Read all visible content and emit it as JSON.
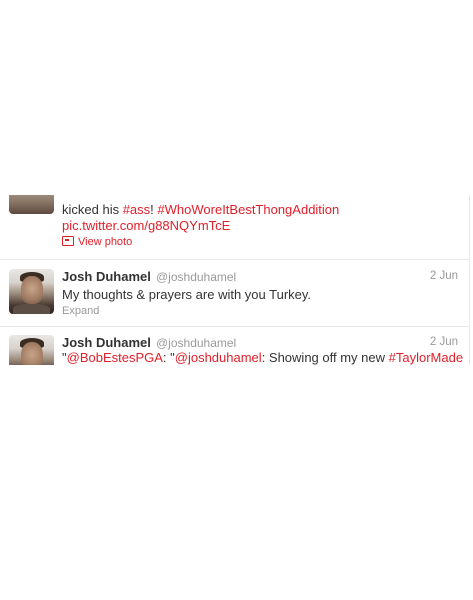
{
  "tweets": [
    {
      "text_prefix": "kicked his ",
      "hashtag1": "#ass",
      "bang": "! ",
      "hashtag2": "#WhoWoreItBestThongAddition",
      "link": "pic.twitter.com/g88NQYmTcE",
      "view_photo": "View photo"
    },
    {
      "name": "Josh Duhamel",
      "handle": "@joshduhamel",
      "date": "2 Jun",
      "text": "My thoughts & prayers are with you Turkey.",
      "expand": "Expand"
    },
    {
      "name": "Josh Duhamel",
      "handle": "@joshduhamel",
      "date": "2 Jun",
      "open_quote": "\"",
      "mention1": "@BobEstesPGA",
      "sep": ": \"",
      "mention2": "@joshduhamel",
      "text_mid": ": Showing off my new ",
      "hashtag": "#TaylorMade"
    }
  ],
  "colors": {
    "link": "#e0202a",
    "muted": "#999999",
    "text": "#333333"
  }
}
